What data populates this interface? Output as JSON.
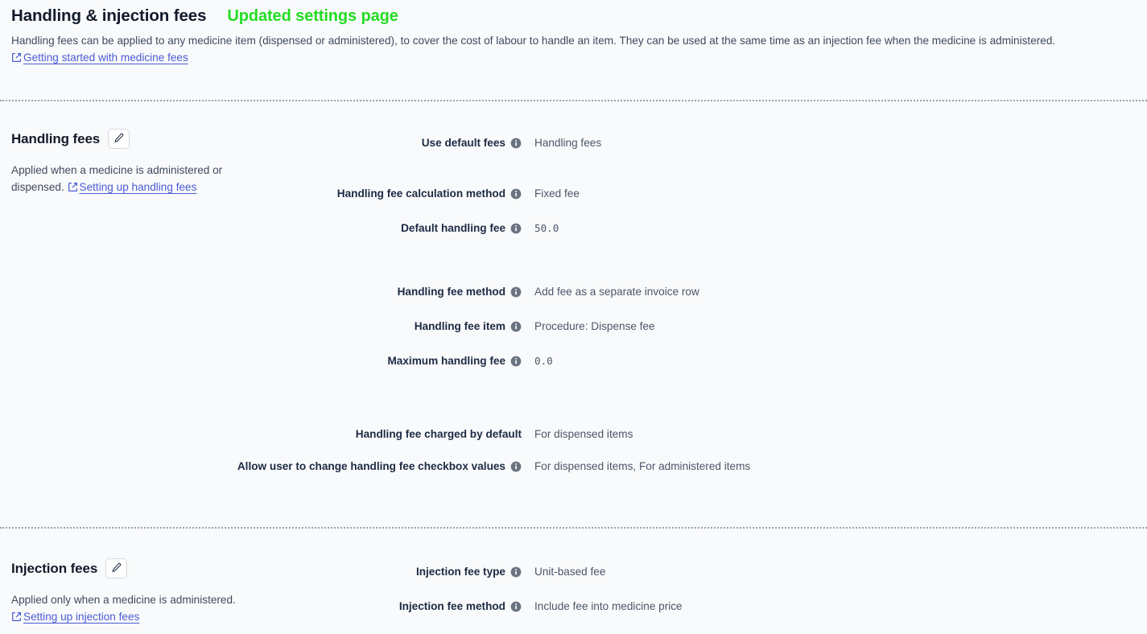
{
  "header": {
    "title": "Handling & injection fees",
    "annotation": "Updated settings page",
    "annotation_color": "#22dd22",
    "description_before": "Handling fees can be applied to any medicine item (dispensed or administered), to cover the cost of labour to handle an item. They can be used at the same time as an injection fee when the medicine is administered. ",
    "description_link": "Getting started with medicine fees",
    "link_icon": "external-link-icon"
  },
  "sections": [
    {
      "id": "handling-fees",
      "title": "Handling fees",
      "edit_button_icon": "pencil-icon",
      "description_before": "Applied when a medicine is administered or dispensed. ",
      "description_link": "Setting up handling fees",
      "fields": [
        {
          "label": "Use default fees",
          "value": "Handling fees",
          "info": true,
          "mono": false
        },
        {
          "label": "Handling fee calculation method",
          "value": "Fixed fee",
          "info": true,
          "mono": false
        },
        {
          "label": "Default handling fee",
          "value": "50.0",
          "info": true,
          "mono": true
        },
        {
          "label": "Handling fee method",
          "value": "Add fee as a separate invoice row",
          "info": true,
          "mono": false
        },
        {
          "label": "Handling fee item",
          "value": "Procedure: Dispense fee",
          "info": true,
          "mono": false
        },
        {
          "label": "Maximum handling fee",
          "value": "0.0",
          "info": true,
          "mono": true
        },
        {
          "label": "Handling fee charged by default",
          "value": "For dispensed items",
          "info": false,
          "mono": false
        },
        {
          "label": "Allow user to change handling fee checkbox values",
          "value": "For dispensed items, For administered items",
          "info": true,
          "mono": false
        }
      ]
    },
    {
      "id": "injection-fees",
      "title": "Injection fees",
      "edit_button_icon": "pencil-icon",
      "description_before": "Applied only when a medicine is administered. ",
      "description_link": "Setting up injection fees",
      "fields": [
        {
          "label": "Injection fee type",
          "value": "Unit-based fee",
          "info": true,
          "mono": false
        },
        {
          "label": "Injection fee method",
          "value": "Include fee into medicine price",
          "info": true,
          "mono": false
        }
      ]
    }
  ],
  "colors": {
    "background": "#f9fafb",
    "title": "#121a2b",
    "label": "#1d2a44",
    "value": "#4b5668",
    "link": "#4a5bd4",
    "divider": "#9aa1ac",
    "info_icon": "#6b7280"
  }
}
